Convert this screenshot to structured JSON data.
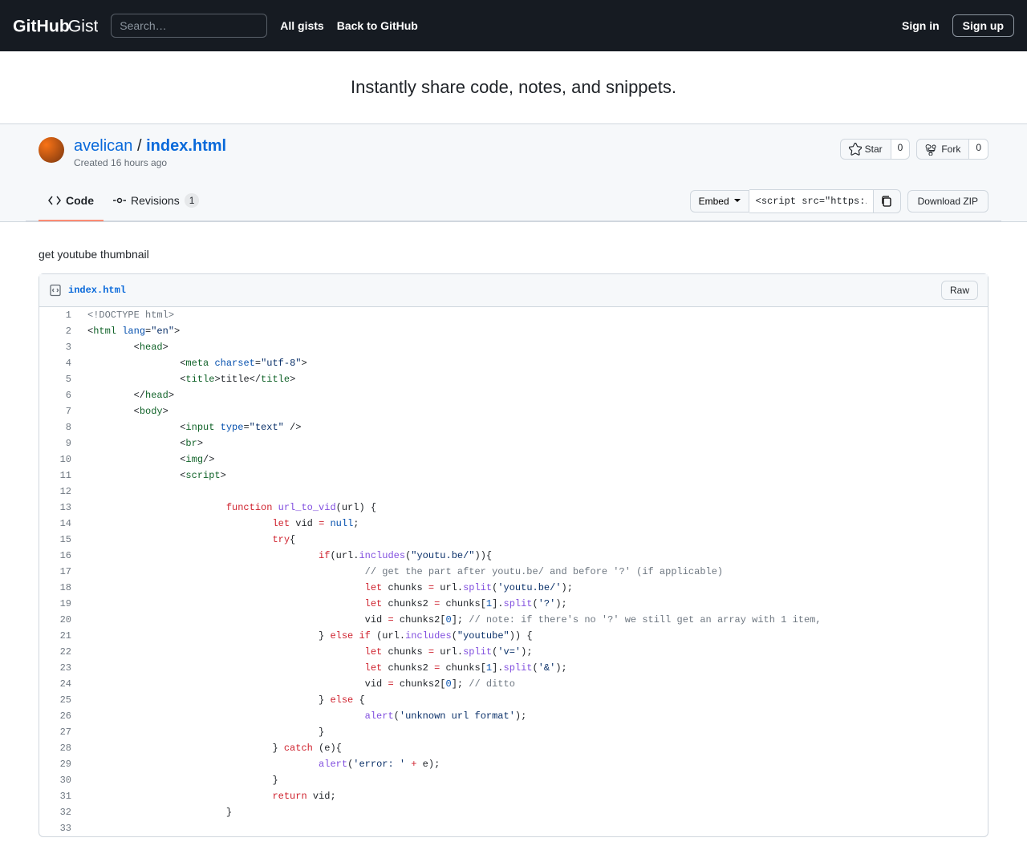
{
  "header": {
    "search_placeholder": "Search…",
    "all_gists": "All gists",
    "back_to_github": "Back to GitHub",
    "sign_in": "Sign in",
    "sign_up": "Sign up"
  },
  "banner": "Instantly share code, notes, and snippets.",
  "gist": {
    "owner": "avelican",
    "filename": "index.html",
    "created": "Created 16 hours ago",
    "star_label": "Star",
    "star_count": "0",
    "fork_label": "Fork",
    "fork_count": "0"
  },
  "tabs": {
    "code": "Code",
    "revisions": "Revisions",
    "revisions_count": "1"
  },
  "actions": {
    "embed": "Embed",
    "embed_value": "<script src=\"https:/",
    "download": "Download ZIP"
  },
  "description": "get youtube thumbnail",
  "file": {
    "name": "index.html",
    "raw": "Raw"
  },
  "code_lines": [
    {
      "n": "1",
      "html": "<span class=c-d>&lt;!DOCTYPE html&gt;</span>"
    },
    {
      "n": "2",
      "html": "&lt;<span class=c-t>html</span> <span class=c-a>lang</span>=<span class=c-s>\"en\"</span>&gt;"
    },
    {
      "n": "3",
      "html": "        &lt;<span class=c-t>head</span>&gt;"
    },
    {
      "n": "4",
      "html": "                &lt;<span class=c-t>meta</span> <span class=c-a>charset</span>=<span class=c-s>\"utf-8\"</span>&gt;"
    },
    {
      "n": "5",
      "html": "                &lt;<span class=c-t>title</span>&gt;title&lt;/<span class=c-t>title</span>&gt;"
    },
    {
      "n": "6",
      "html": "        &lt;/<span class=c-t>head</span>&gt;"
    },
    {
      "n": "7",
      "html": "        &lt;<span class=c-t>body</span>&gt;"
    },
    {
      "n": "8",
      "html": "                &lt;<span class=c-t>input</span> <span class=c-a>type</span>=<span class=c-s>\"text\"</span> /&gt;"
    },
    {
      "n": "9",
      "html": "                &lt;<span class=c-t>br</span>&gt;"
    },
    {
      "n": "10",
      "html": "                &lt;<span class=c-t>img</span>/&gt;"
    },
    {
      "n": "11",
      "html": "                &lt;<span class=c-t>script</span>&gt;"
    },
    {
      "n": "12",
      "html": ""
    },
    {
      "n": "13",
      "html": "                        <span class=c-k>function</span> <span class=c-f>url_to_vid</span>(url) {"
    },
    {
      "n": "14",
      "html": "                                <span class=c-k>let</span> vid <span class=c-k>=</span> <span class=c-n>null</span>;"
    },
    {
      "n": "15",
      "html": "                                <span class=c-k>try</span>{"
    },
    {
      "n": "16",
      "html": "                                        <span class=c-k>if</span>(url.<span class=c-f>includes</span>(<span class=c-s>\"youtu.be/\"</span>)){"
    },
    {
      "n": "17",
      "html": "                                                <span class=c-d>// get the part after youtu.be/ and before '?' (if applicable)</span>"
    },
    {
      "n": "18",
      "html": "                                                <span class=c-k>let</span> chunks <span class=c-k>=</span> url.<span class=c-f>split</span>(<span class=c-s>'youtu.be/'</span>);"
    },
    {
      "n": "19",
      "html": "                                                <span class=c-k>let</span> chunks2 <span class=c-k>=</span> chunks[<span class=c-n>1</span>].<span class=c-f>split</span>(<span class=c-s>'?'</span>);"
    },
    {
      "n": "20",
      "html": "                                                vid <span class=c-k>=</span> chunks2[<span class=c-n>0</span>]; <span class=c-d>// note: if there's no '?' we still get an array with 1 item,</span>"
    },
    {
      "n": "21",
      "html": "                                        } <span class=c-k>else</span> <span class=c-k>if</span> (url.<span class=c-f>includes</span>(<span class=c-s>\"youtube\"</span>)) {"
    },
    {
      "n": "22",
      "html": "                                                <span class=c-k>let</span> chunks <span class=c-k>=</span> url.<span class=c-f>split</span>(<span class=c-s>'v='</span>);"
    },
    {
      "n": "23",
      "html": "                                                <span class=c-k>let</span> chunks2 <span class=c-k>=</span> chunks[<span class=c-n>1</span>].<span class=c-f>split</span>(<span class=c-s>'&amp;'</span>);"
    },
    {
      "n": "24",
      "html": "                                                vid <span class=c-k>=</span> chunks2[<span class=c-n>0</span>]; <span class=c-d>// ditto</span>"
    },
    {
      "n": "25",
      "html": "                                        } <span class=c-k>else</span> {"
    },
    {
      "n": "26",
      "html": "                                                <span class=c-f>alert</span>(<span class=c-s>'unknown url format'</span>);"
    },
    {
      "n": "27",
      "html": "                                        }"
    },
    {
      "n": "28",
      "html": "                                } <span class=c-k>catch</span> (e){"
    },
    {
      "n": "29",
      "html": "                                        <span class=c-f>alert</span>(<span class=c-s>'error: '</span> <span class=c-k>+</span> e);"
    },
    {
      "n": "30",
      "html": "                                }"
    },
    {
      "n": "31",
      "html": "                                <span class=c-k>return</span> vid;"
    },
    {
      "n": "32",
      "html": "                        }"
    },
    {
      "n": "33",
      "html": ""
    }
  ]
}
